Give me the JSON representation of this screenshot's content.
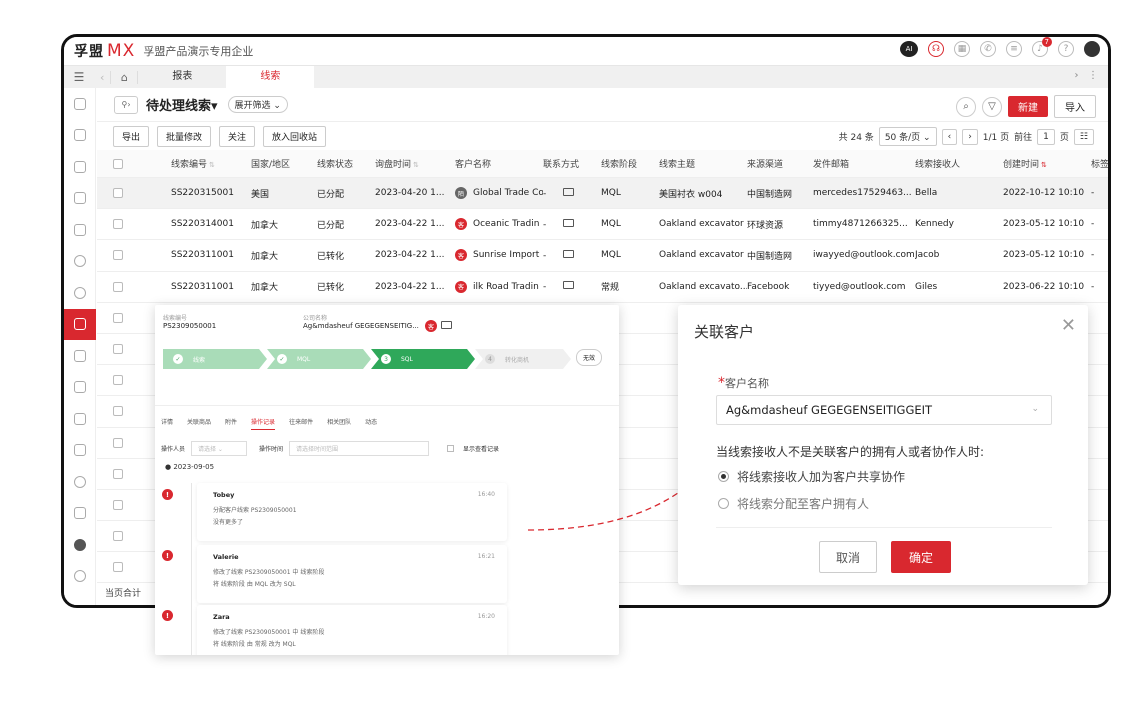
{
  "app": {
    "logo_cn": "孚盟",
    "logo_mx": "MX",
    "company": "孚盟产品演示专用企业",
    "notifications": "7",
    "ai_label": "AI",
    "brand_color": "#d9282f"
  },
  "tabs": {
    "items": [
      {
        "label": "报表"
      },
      {
        "label": "线索"
      }
    ]
  },
  "header": {
    "view_title": "待处理线索▾",
    "filter_toggle": "展开筛选 ⌄",
    "new_button": "新建",
    "import_button": "导入"
  },
  "toolbar": {
    "export": "导出",
    "bulk_edit": "批量修改",
    "follow": "关注",
    "recycle": "放入回收站"
  },
  "pager": {
    "total": "共 24 条",
    "page_size": "50 条/页",
    "page_info": "1/1 页",
    "goto_label": "前往",
    "goto_value": "1",
    "page_suffix": "页"
  },
  "table": {
    "columns": [
      "线索编号",
      "国家/地区",
      "线索状态",
      "询盘时间",
      "客户名称",
      "联系方式",
      "线索阶段",
      "线索主题",
      "来源渠道",
      "发件邮箱",
      "线索接收人",
      "创建时间",
      "标签"
    ],
    "rows": [
      {
        "no": "SS220315001",
        "country": "美国",
        "status": "已分配",
        "time": "2023-04-20 1...",
        "badge": "陌",
        "cust": "Global Trade Co",
        "contact": "-",
        "stage": "MQL",
        "topic": "美国衬衣 w004",
        "channel": "中国制造网",
        "email": "mercedes17529463...",
        "recv": "Bella",
        "created": "2022-10-12 10:10",
        "tag": "-"
      },
      {
        "no": "SS220314001",
        "country": "加拿大",
        "status": "已分配",
        "time": "2023-04-22 1...",
        "badge": "客",
        "cust": "Oceanic Tradin",
        "contact": "-",
        "stage": "MQL",
        "topic": "Oakland excavator",
        "channel": "环球资源",
        "email": "timmy4871266325...",
        "recv": "Kennedy",
        "created": "2023-05-12 10:10",
        "tag": "-"
      },
      {
        "no": "SS220311001",
        "country": "加拿大",
        "status": "已转化",
        "time": "2023-04-22 1...",
        "badge": "客",
        "cust": "Sunrise Import",
        "contact": "-",
        "stage": "MQL",
        "topic": "Oakland excavator",
        "channel": "中国制造网",
        "email": "iwayyed@outlook.com",
        "recv": "Jacob",
        "created": "2023-05-12 10:10",
        "tag": "-"
      },
      {
        "no": "SS220311001",
        "country": "加拿大",
        "status": "已转化",
        "time": "2023-04-22 1...",
        "badge": "客",
        "cust": "ilk Road Tradin",
        "contact": "-",
        "stage": "常规",
        "topic": "Oakland excavato...",
        "channel": "Facebook",
        "email": "tiyyed@outlook.com",
        "recv": "Giles",
        "created": "2023-06-22 10:10",
        "tag": "-"
      }
    ],
    "footer": "当页合计"
  },
  "detail": {
    "no_label": "线索编号",
    "no_value": "PS2309050001",
    "company_label": "公司名称",
    "company_value": "Ag&mdasheuf GEGEGENSEITIG...",
    "company_badge": "客",
    "stages": [
      {
        "num": "✓",
        "label": "线索"
      },
      {
        "num": "✓",
        "label": "MQL"
      },
      {
        "num": "3",
        "label": "SQL"
      },
      {
        "num": "4",
        "label": "转化商机"
      }
    ],
    "invalid": "无效",
    "tabs": [
      "详情",
      "关联商品",
      "附件",
      "操作记录",
      "往来邮件",
      "相关团队",
      "动态"
    ],
    "operator_label": "操作人员",
    "operator_placeholder": "请选择 ⌄",
    "optime_label": "操作时间",
    "optime_placeholder": "请选择时间范围",
    "show_view_records": "显示查看记录",
    "date": "2023-09-05",
    "logs": [
      {
        "user": "Tobey",
        "time": "16:40",
        "l1": "分配客户线索 PS2309050001",
        "l2": "没有更多了"
      },
      {
        "user": "Valerie",
        "time": "16:21",
        "l1": "修改了线索 PS2309050001 中 线索阶段",
        "l2": "将 线索阶段 由 MQL 改为 SQL"
      },
      {
        "user": "Zara",
        "time": "16:20",
        "l1": "修改了线索 PS2309050001 中 线索阶段",
        "l2": "将 线索阶段 由 常规 改为 MQL"
      }
    ]
  },
  "modal": {
    "title": "关联客户",
    "customer_label": "客户名称",
    "customer_value": "Ag&mdasheuf GEGEGENSEITIGGEIT",
    "question": "当线索接收人不是关联客户的拥有人或者协作人时:",
    "option1": "将线索接收人加为客户共享协作",
    "option2": "将线索分配至客户拥有人",
    "cancel": "取消",
    "confirm": "确定"
  }
}
